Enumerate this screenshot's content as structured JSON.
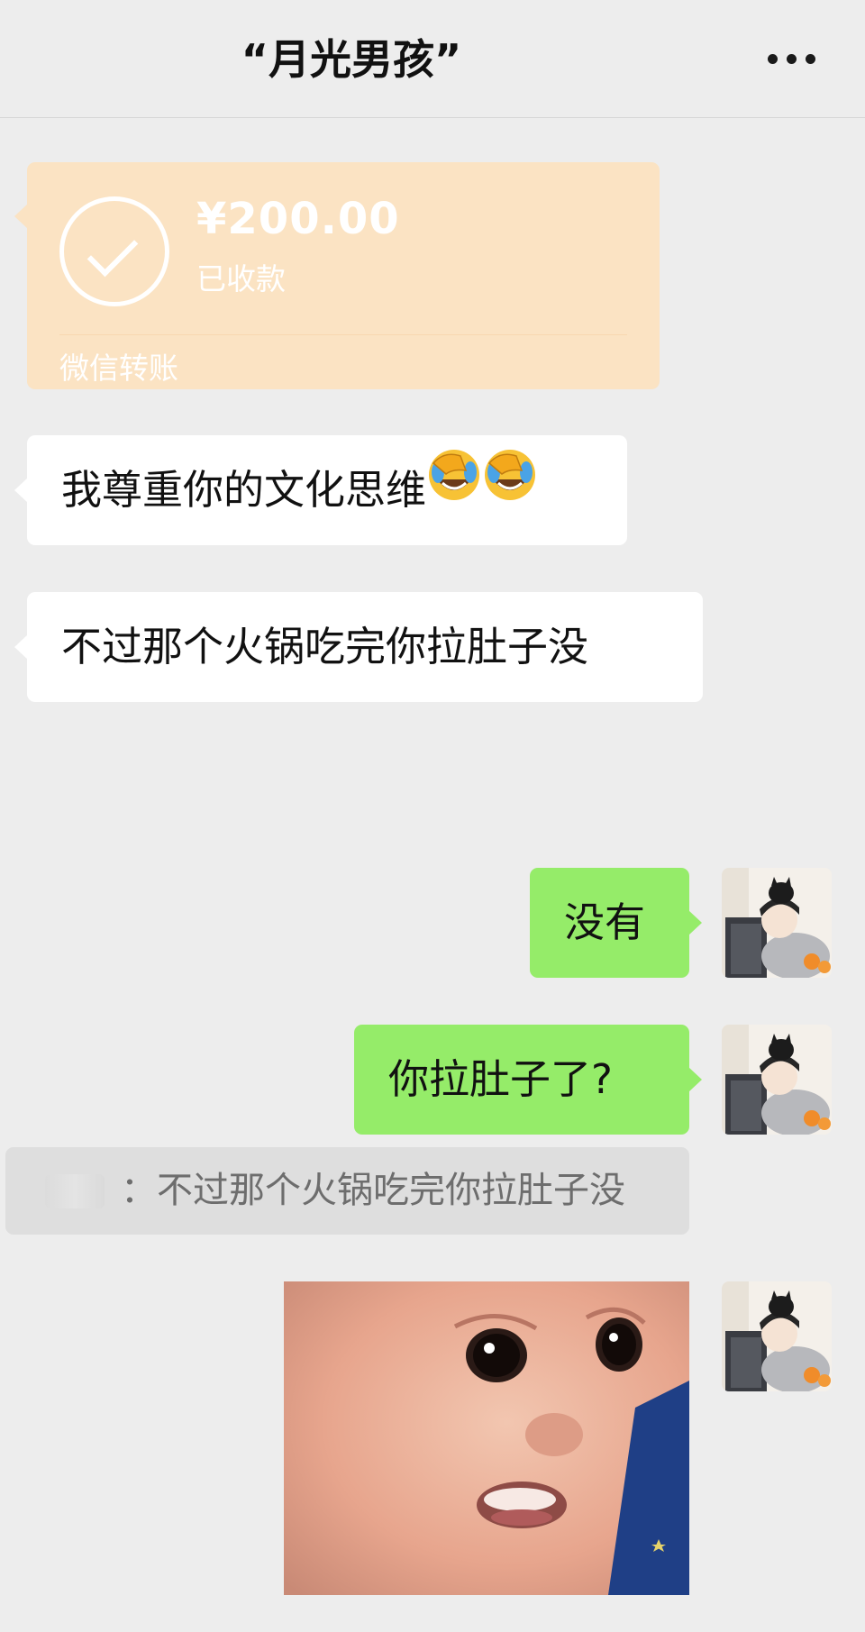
{
  "header": {
    "title": "“月光男孩”",
    "more_icon": "more-icon"
  },
  "transfer": {
    "amount": "¥200.00",
    "status": "已收款",
    "brand": "微信转账",
    "icon": "check-circle-icon"
  },
  "messages": [
    {
      "side": "in",
      "text": "我尊重你的文化思维",
      "emoji": [
        "face-palm-laugh-emoji",
        "face-palm-laugh-emoji"
      ]
    },
    {
      "side": "in",
      "text": "不过那个火锅吃完你拉肚子没"
    },
    {
      "side": "out",
      "text": "没有"
    },
    {
      "side": "out",
      "text": "你拉肚子了?"
    }
  ],
  "quote": {
    "separator": "：",
    "text": "不过那个火锅吃完你拉肚子没"
  },
  "colors": {
    "background": "#ededed",
    "incoming_bubble": "#ffffff",
    "outgoing_bubble": "#95ec69",
    "transfer_card": "#fbe3c3"
  }
}
